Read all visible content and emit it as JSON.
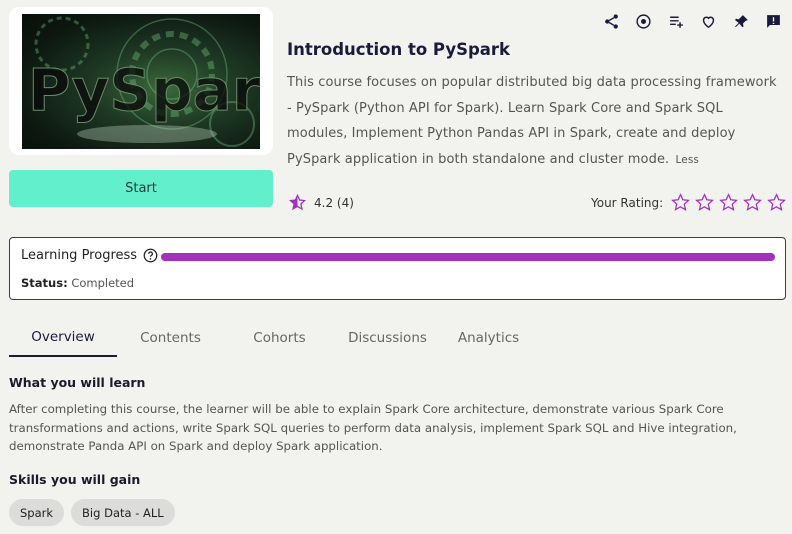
{
  "course": {
    "thumbnail_text": "PySpark",
    "title": "Introduction to PySpark",
    "description": "This course focuses on popular distributed big data processing framework - PySpark (Python API for Spark). Learn Spark Core and Spark SQL modules, Implement Python Pandas API in Spark, create and deploy PySpark application in both standalone and cluster mode.",
    "less_label": "Less",
    "start_label": "Start",
    "rating_text": "4.2 (4)",
    "your_rating_label": "Your Rating:"
  },
  "actions": [
    "share-icon",
    "target-icon",
    "playlist-add-icon",
    "heart-icon",
    "pin-icon",
    "feedback-icon"
  ],
  "progress": {
    "label": "Learning Progress",
    "fraction": 1.0,
    "status_label": "Status:",
    "status_value": "Completed"
  },
  "tabs": [
    {
      "label": "Overview",
      "active": true
    },
    {
      "label": "Contents",
      "active": false
    },
    {
      "label": "Cohorts",
      "active": false
    },
    {
      "label": "Discussions",
      "active": false
    },
    {
      "label": "Analytics",
      "active": false
    }
  ],
  "overview": {
    "learn_heading": "What you will learn",
    "learn_text": "After completing this course, the learner will be able to explain Spark Core architecture, demonstrate various Spark Core transformations and actions, write Spark SQL queries to perform data analysis, implement Spark SQL and Hive integration, demonstrate Panda API on Spark and deploy Spark application.",
    "skills_heading": "Skills you will gain",
    "skills": [
      "Spark",
      "Big Data - ALL"
    ]
  },
  "colors": {
    "accent": "#a331bc",
    "start_button": "#62efcb",
    "title": "#1a1a3a"
  }
}
